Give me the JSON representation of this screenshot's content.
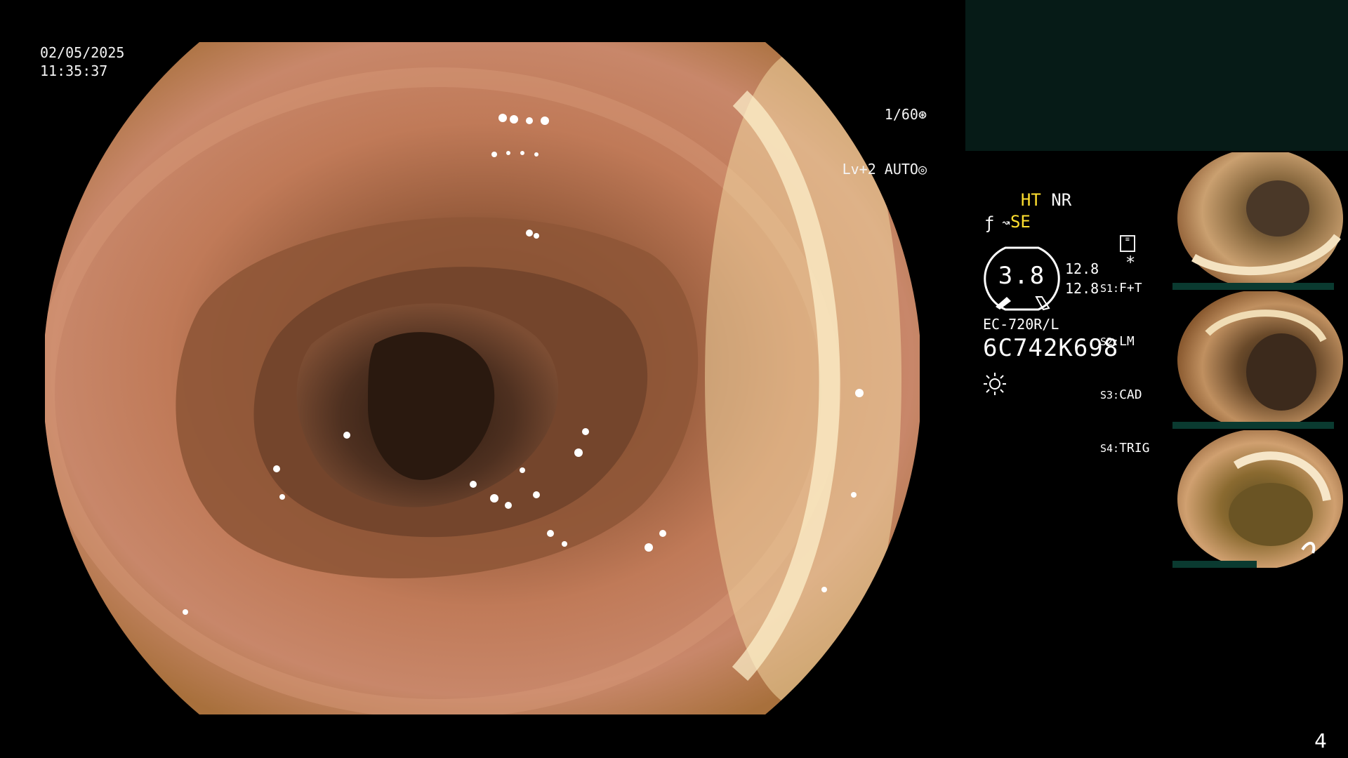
{
  "overlay": {
    "date": "02/05/2025",
    "time": "11:35:37",
    "shutter": "1/60",
    "level_mode": "Lv+2 AUTO",
    "shutter_icon": "aperture-icon",
    "auto_icon": "auto-iris-icon"
  },
  "status": {
    "ht": "HT",
    "nr": "NR",
    "se": "SE",
    "se_icon": "scope-arrow-icon",
    "f_icon": "flat-symbol-icon",
    "memo_icon": "memory-card-icon",
    "asterisk": "*",
    "gauge_value": "3.8",
    "gauge_left": "12.8",
    "gauge_left2": "12.8",
    "switches": [
      {
        "index": "S1:",
        "label": "F+T"
      },
      {
        "index": "S2:",
        "label": "LM"
      },
      {
        "index": "S3:",
        "label": "CAD"
      },
      {
        "index": "S4:",
        "label": "TRIG"
      }
    ],
    "model": "EC-720R/L",
    "serial": "6C742K698",
    "light_icon": "light-source-icon"
  },
  "thumbnails": [
    {
      "name": "capture-1"
    },
    {
      "name": "capture-2"
    },
    {
      "name": "capture-3"
    }
  ],
  "page_number": "4",
  "colors": {
    "panel_bg": "#061b17",
    "accent_yellow": "#ffdf2f",
    "tissue": "#b96a4c"
  }
}
